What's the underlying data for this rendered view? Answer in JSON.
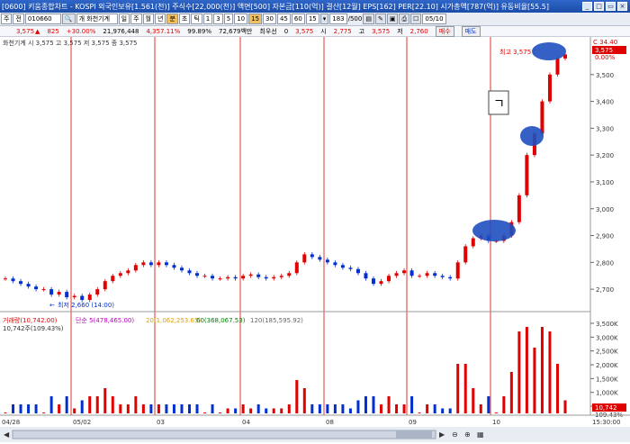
{
  "window": {
    "title": "[0600] 키움종합차트 - KOSPI 외국인보유[1.561(천)] 주식수[22,000(천)] 액면[500] 자본금[110(억)] 결산[12월] EPS[162] PER[22.10] 시가총액[787(억)] 유동비율[55.5]"
  },
  "toolbar": {
    "mode": "주",
    "market": "전",
    "code": "010660",
    "name": "개 화천기계",
    "periods": [
      "일",
      "주",
      "월",
      "년",
      "분",
      "초",
      "틱"
    ],
    "selected_period": "분",
    "minutes": [
      "1",
      "3",
      "5",
      "10",
      "15",
      "30",
      "45",
      "60"
    ],
    "selected_minute": "15",
    "interval": "15",
    "count": "183",
    "count_total": "/500",
    "date": "05/10"
  },
  "quote": {
    "price": "3,575",
    "change": "825",
    "change_pct": "+30.00%",
    "volume": "21,976,448",
    "volume_pct": "4,357.11%",
    "ratio": "99.89%",
    "amount": "72,679백만",
    "pref_label": "최우선",
    "pref_value": "0",
    "last": "3,575",
    "open_label": "시",
    "open": "2,775",
    "high_label": "고",
    "high": "3,575",
    "low_label": "저",
    "low": "2,760",
    "buy_btn": "매수",
    "sell_btn": "매도"
  },
  "chart_legend": "화천기계 시 3,575 고 3,575 저 3,575 종 3,575",
  "annotations": {
    "high_label": "최고 3,575 (",
    "low_label": "최저 2,660 (14:00)",
    "box_glyph": "ㄱ"
  },
  "price_axis": {
    "ticks": [
      "3,500",
      "3,400",
      "3,300",
      "3,200",
      "3,100",
      "3,000",
      "2,900",
      "2,800",
      "2,700"
    ],
    "top_label": "C 34.40",
    "current_box": "3,575",
    "pct_label": "0.00%"
  },
  "volume_legend": {
    "title": "거래량(10,742.00)",
    "ma5": "단순 5(478,465.00)",
    "ma20": "20(1,062,253.65)",
    "ma60": "60(368,067.53)",
    "ma120": "120(185,595.92)",
    "sub": "10,742주(109.43%)"
  },
  "volume_axis": {
    "ticks": [
      "3,500K",
      "3,000K",
      "2,500K",
      "2,000K",
      "1,500K",
      "1,000K",
      "500,000"
    ],
    "current_box": "10,742",
    "pct_label": "109.43%"
  },
  "date_axis": {
    "labels": [
      "04/28",
      "05/02",
      "03",
      "04",
      "08",
      "09",
      "10"
    ],
    "time": "15:30:00"
  },
  "chart_data": {
    "type": "candlestick",
    "ylim": [
      2640,
      3600
    ],
    "y_ticks": [
      2700,
      2800,
      2900,
      3000,
      3100,
      3200,
      3300,
      3400,
      3500
    ],
    "day_labels": [
      "05/02",
      "03",
      "04",
      "08",
      "09",
      "10"
    ],
    "note": "15-minute candles; values estimated from gridlines",
    "closes": [
      2740,
      2730,
      2720,
      2710,
      2700,
      2700,
      2680,
      2690,
      2670,
      2675,
      2660,
      2680,
      2700,
      2730,
      2750,
      2760,
      2770,
      2790,
      2800,
      2790,
      2800,
      2790,
      2780,
      2770,
      2760,
      2750,
      2750,
      2740,
      2740,
      2745,
      2740,
      2750,
      2755,
      2745,
      2740,
      2745,
      2750,
      2760,
      2800,
      2830,
      2820,
      2810,
      2800,
      2790,
      2780,
      2775,
      2760,
      2740,
      2720,
      2730,
      2750,
      2760,
      2770,
      2750,
      2750,
      2760,
      2750,
      2745,
      2740,
      2800,
      2860,
      2890,
      2900,
      2880,
      2880,
      2900,
      2950,
      3050,
      3200,
      3280,
      3400,
      3500,
      3560,
      3575
    ]
  }
}
